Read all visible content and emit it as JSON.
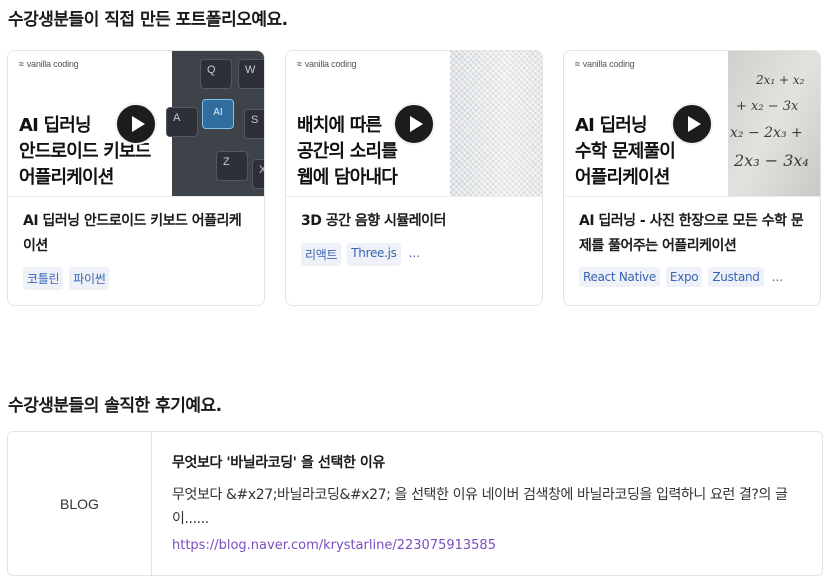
{
  "portfolio": {
    "heading": "수강생분들이 직접 만든 포트폴리오예요.",
    "cards": [
      {
        "brand": "vanilla coding",
        "thumb_lines": [
          "AI 딥러닝",
          "안드로이드 키보드",
          "어플리케이션"
        ],
        "title": "AI 딥러닝 안드로이드 키보드 어플리케이션",
        "tags": [
          "코틀린",
          "파이썬"
        ],
        "more": "",
        "image": "keyboard-photo",
        "keys": [
          "Q",
          "W",
          "A",
          "S",
          "Z",
          "X"
        ],
        "key_ai_label": "AI"
      },
      {
        "brand": "vanilla coding",
        "thumb_lines": [
          "배치에 따른",
          "공간의 소리를",
          "웹에 담아내다"
        ],
        "title": "3D 공간 음향 시뮬레이터",
        "tags": [
          "리액트",
          "Three.js"
        ],
        "more": "...",
        "image": "speaker-mesh-photo"
      },
      {
        "brand": "vanilla coding",
        "thumb_lines": [
          "AI 딥러닝",
          "수학 문제풀이",
          "어플리케이션"
        ],
        "title": "AI 딥러닝 - 사진 한장으로 모든 수학 문제를 풀어주는 어플리케이션",
        "tags": [
          "React Native",
          "Expo",
          "Zustand"
        ],
        "more": "...",
        "image": "math-equation-photo",
        "math": [
          "2x₁ + x₂",
          "+ x₂ − 3x",
          "x₂ − 2x₃ +",
          "2x₃ − 3x₄"
        ]
      }
    ]
  },
  "reviews": {
    "heading": "수강생분들의 솔직한 후기예요.",
    "items": [
      {
        "source": "BLOG",
        "title": "무엇보다 '바닐라코딩' 을 선택한 이유",
        "body": "무엇보다 &#x27;바닐라코딩&#x27; 을 선택한 이유 네이버 검색창에 바닐라코딩을 입력하니 요런 결?의 글이......",
        "link": "https://blog.naver.com/krystarline/223075913585"
      }
    ]
  },
  "colors": {
    "tag_bg": "#eef2f8",
    "tag_text": "#3a64b0",
    "link": "#7a4fc0",
    "border": "#e3e3e3"
  }
}
